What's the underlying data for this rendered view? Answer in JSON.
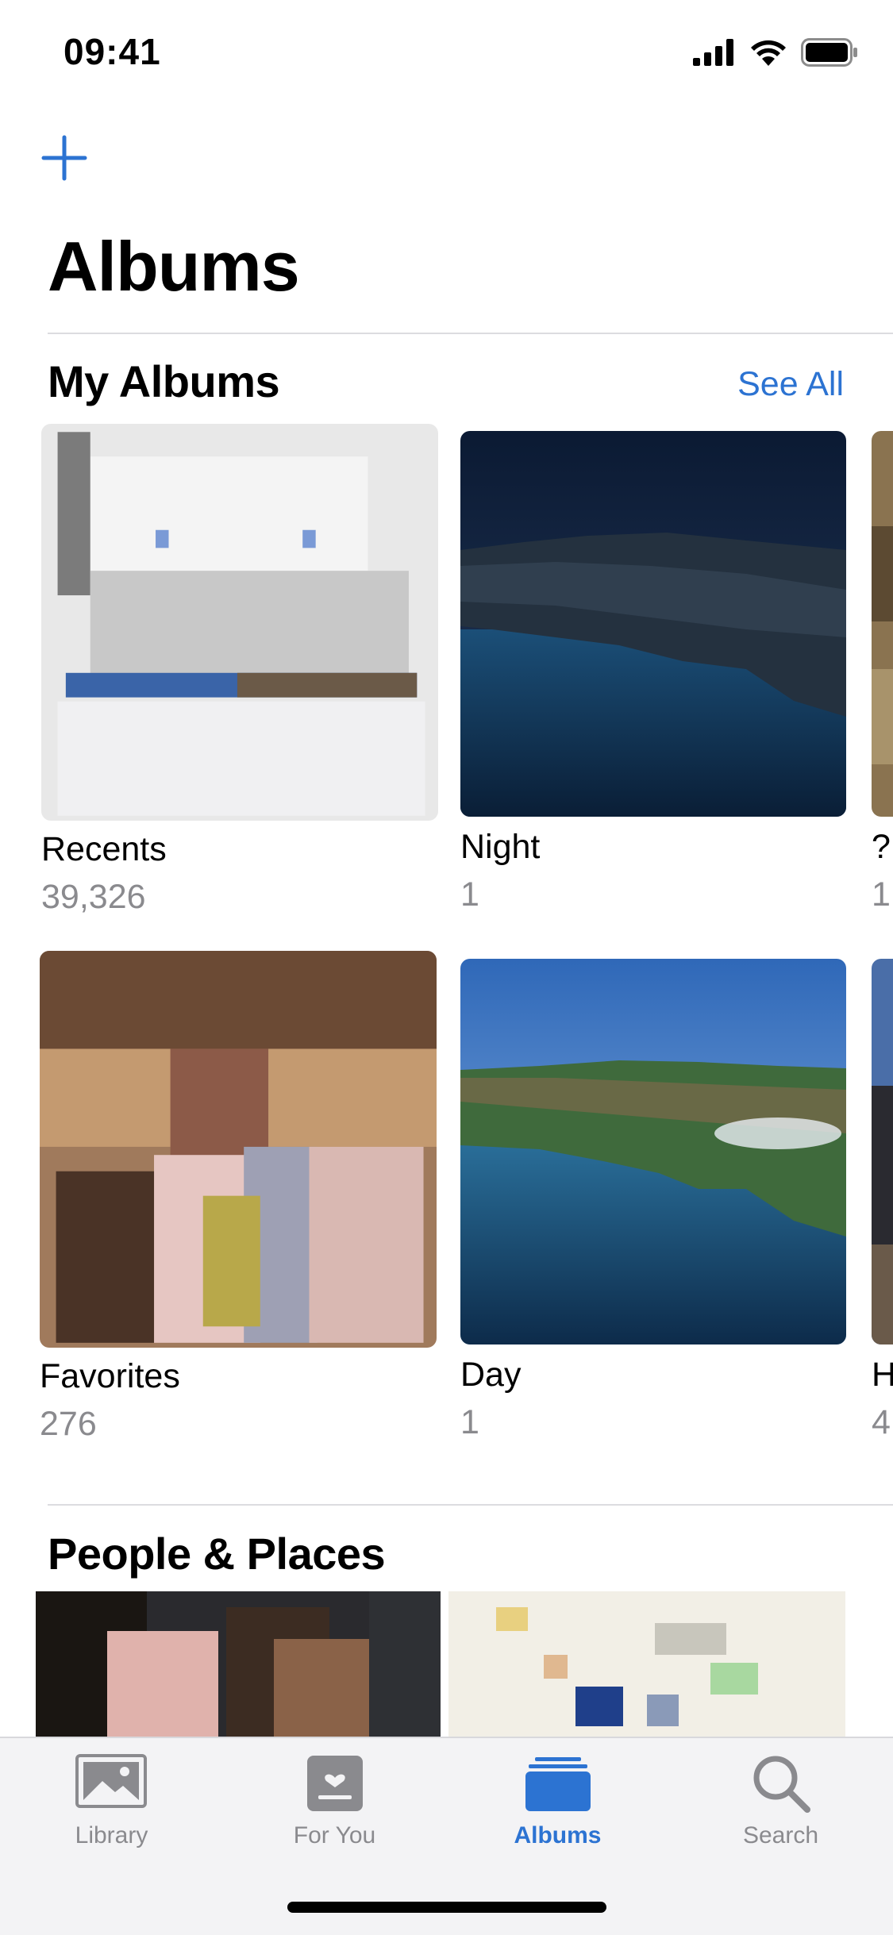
{
  "status_bar": {
    "time": "09:41"
  },
  "header": {
    "title": "Albums"
  },
  "my_albums": {
    "title": "My Albums",
    "see_all": "See All",
    "albums": [
      {
        "name": "Recents",
        "count": "39,326"
      },
      {
        "name": "Night",
        "count": "1"
      },
      {
        "name": "?",
        "count": "1"
      },
      {
        "name": "Favorites",
        "count": "276"
      },
      {
        "name": "Day",
        "count": "1"
      },
      {
        "name": "H",
        "count": "4"
      }
    ]
  },
  "people_places": {
    "title": "People & Places"
  },
  "tab_bar": {
    "tabs": [
      {
        "label": "Library",
        "icon": "photo-library-icon"
      },
      {
        "label": "For You",
        "icon": "for-you-icon"
      },
      {
        "label": "Albums",
        "icon": "albums-icon",
        "active": true
      },
      {
        "label": "Search",
        "icon": "search-icon"
      }
    ]
  },
  "colors": {
    "accent": "#2c73d2",
    "secondary_text": "#8a8a8e"
  }
}
